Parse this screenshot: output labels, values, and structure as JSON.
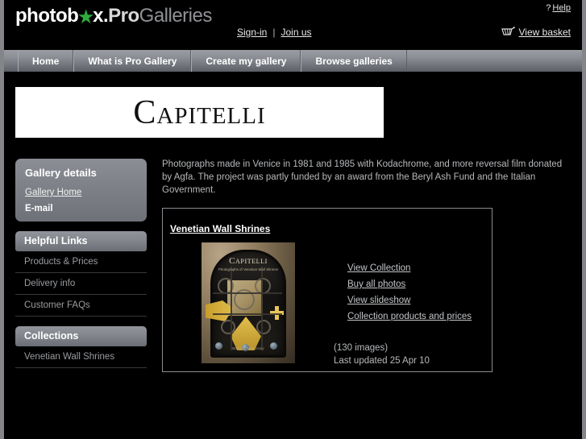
{
  "header": {
    "logo": {
      "part1": "photob",
      "star_icon": "★",
      "part2": "x.",
      "pro": "Pro",
      "galleries": "Galleries"
    },
    "help": {
      "marker": "?",
      "label": "Help"
    },
    "auth": {
      "signin": "Sign-in",
      "separator": "|",
      "joinus": "Join us"
    },
    "basket": {
      "label": "View basket",
      "icon": "basket-icon"
    }
  },
  "nav": {
    "items": [
      {
        "label": "Home"
      },
      {
        "label": "What is Pro Gallery"
      },
      {
        "label": "Create my gallery"
      },
      {
        "label": "Browse galleries"
      }
    ]
  },
  "banner": {
    "title": "Capitelli"
  },
  "sidebar": {
    "gallery_details": {
      "title": "Gallery details",
      "home_link": "Gallery Home",
      "email_label": "E-mail"
    },
    "helpful_links": {
      "title": "Helpful Links",
      "items": [
        {
          "label": "Products & Prices"
        },
        {
          "label": "Delivery info"
        },
        {
          "label": "Customer FAQs"
        }
      ]
    },
    "collections": {
      "title": "Collections",
      "items": [
        {
          "label": "Venetian Wall Shrines"
        }
      ]
    }
  },
  "main": {
    "description": "Photographs made in Venice in 1981 and 1985 with Kodachrome, and more reversal film donated by Agfa. The project was partly funded by an award from the Beryl Ash Fund and the Italian Government.",
    "collection": {
      "title": "Venetian Wall Shrines",
      "thumbnail": {
        "cover_title": "Capitelli",
        "cover_subtitle": "Photographs of Venetian Wall Shrines",
        "cover_footer": "Melvin Sokolsky"
      },
      "actions": [
        {
          "label": "View Collection"
        },
        {
          "label": "Buy all photos"
        },
        {
          "label": "View slideshow"
        },
        {
          "label": "Collection products and prices"
        }
      ],
      "image_count": "(130 images)",
      "last_updated": "Last updated 25 Apr 10"
    }
  },
  "colors": {
    "page_background": "#000000",
    "page_border": "#838589",
    "nav_gradient_top": "#9a9da3",
    "nav_gradient_bottom": "#5b5e65",
    "panel_gray": "#7e8188",
    "logo_star_green": "#2faa3f",
    "banner_background": "#ffffff",
    "body_text": "#b6b8bb",
    "link_text": "#c3c5c8"
  }
}
